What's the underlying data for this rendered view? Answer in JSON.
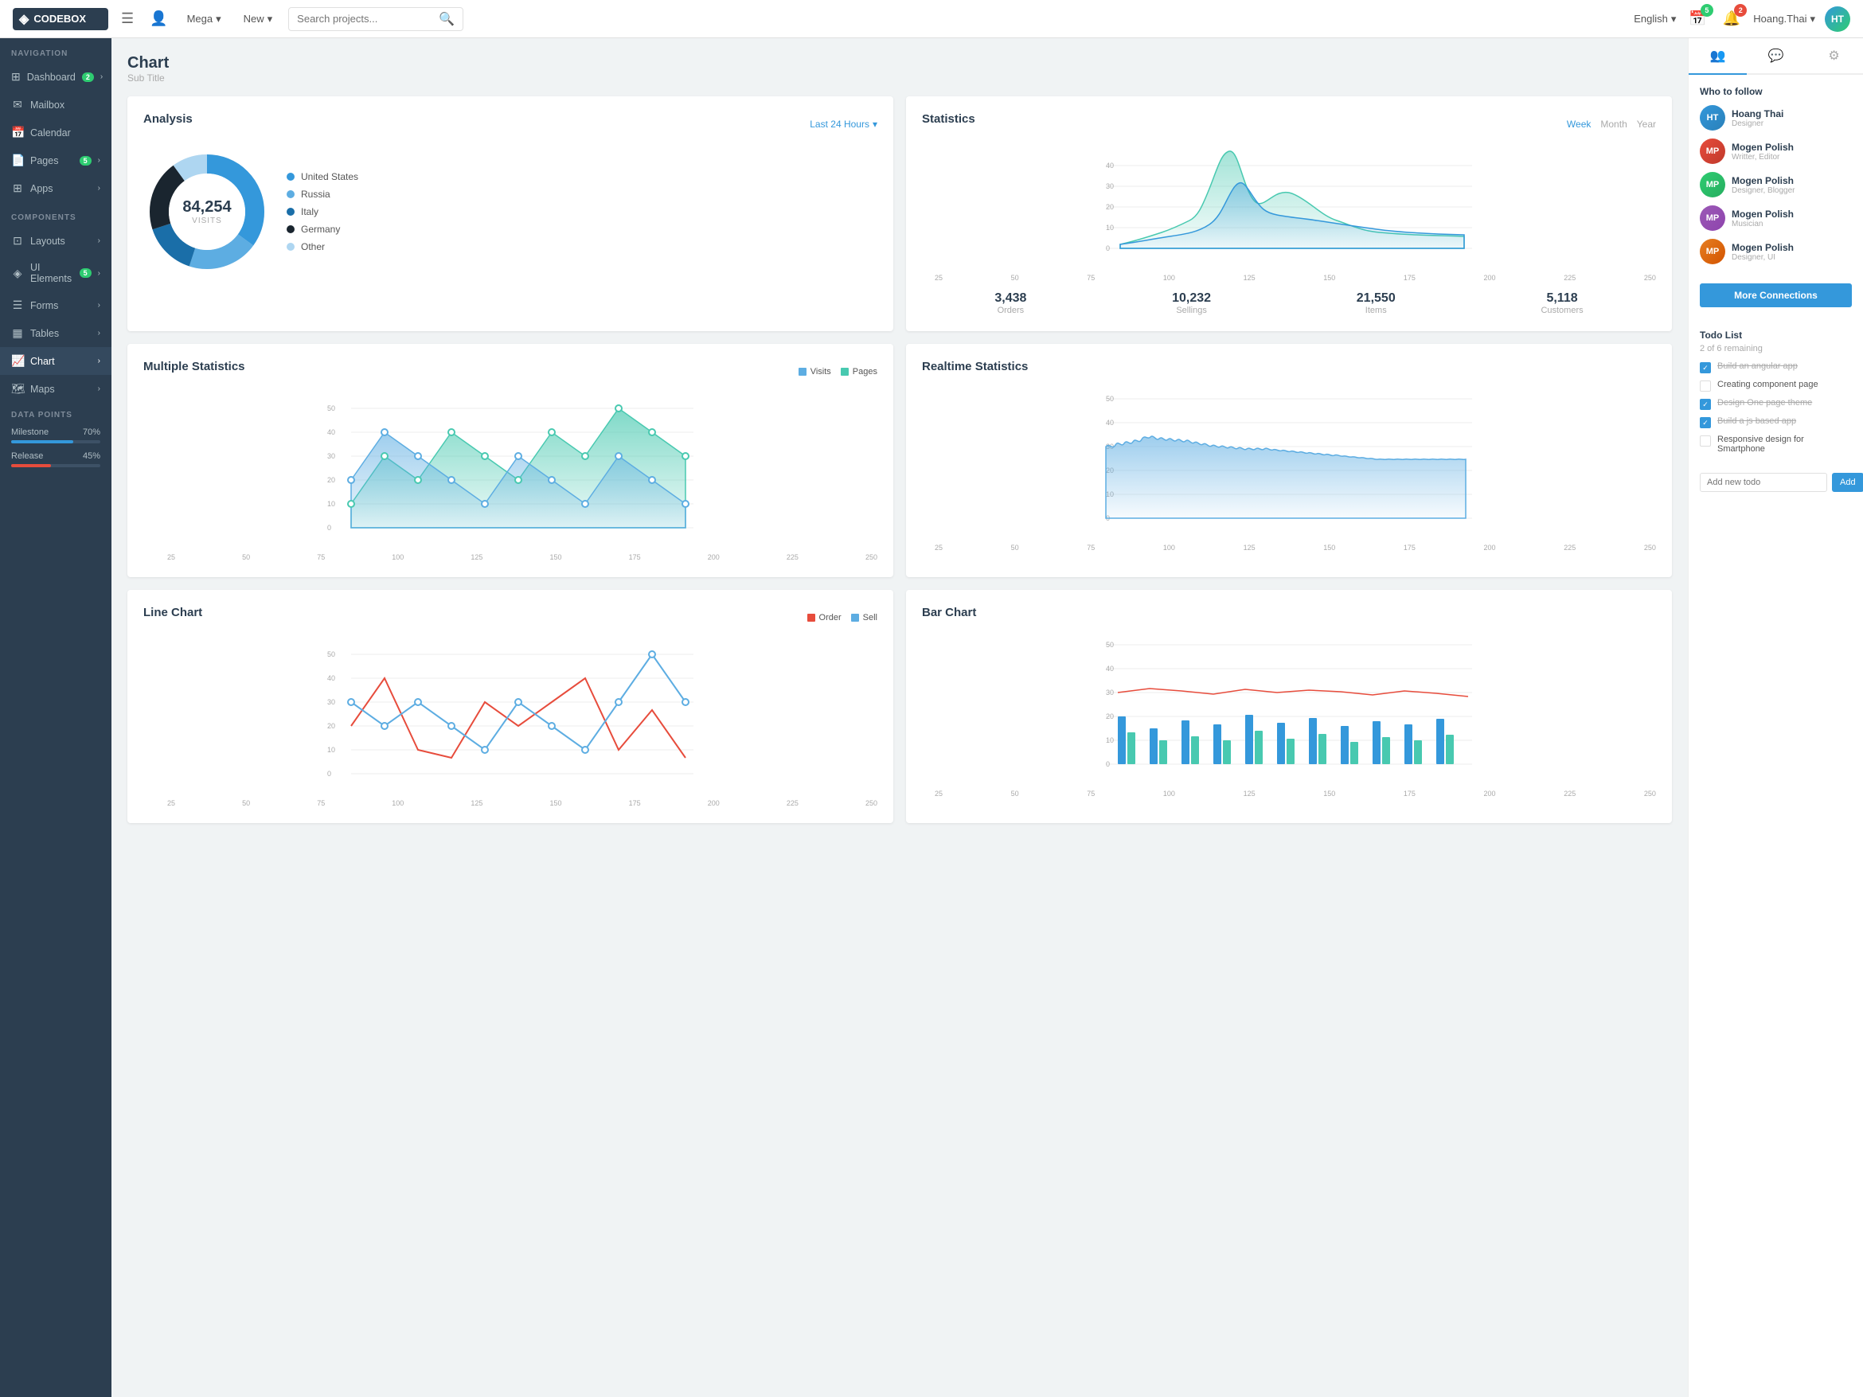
{
  "topnav": {
    "logo_text": "CODEBOX",
    "menu_btn": "☰",
    "user_icon": "👤",
    "mega_label": "Mega",
    "new_label": "New",
    "search_placeholder": "Search projects...",
    "lang_label": "English",
    "calendar_badge": "5",
    "bell_badge": "2",
    "username": "Hoang.Thai"
  },
  "sidebar": {
    "nav_label": "Navigation",
    "items": [
      {
        "label": "Dashboard",
        "icon": "⊞",
        "badge": "2",
        "arrow": "›"
      },
      {
        "label": "Mailbox",
        "icon": "✉"
      },
      {
        "label": "Calendar",
        "icon": "📅"
      },
      {
        "label": "Pages",
        "icon": "📄",
        "badge": "5",
        "arrow": "›"
      },
      {
        "label": "Apps",
        "icon": "⊞",
        "arrow": "›"
      }
    ],
    "components_label": "Components",
    "components": [
      {
        "label": "Layouts",
        "icon": "⊡",
        "arrow": "›"
      },
      {
        "label": "UI Elements",
        "icon": "◈",
        "badge": "5",
        "arrow": "›"
      },
      {
        "label": "Forms",
        "icon": "☰",
        "arrow": "›"
      },
      {
        "label": "Tables",
        "icon": "▦",
        "arrow": "›"
      },
      {
        "label": "Chart",
        "icon": "📈",
        "arrow": "›"
      },
      {
        "label": "Maps",
        "icon": "🗺",
        "arrow": "›"
      }
    ],
    "data_points_label": "Data Points",
    "milestone_label": "Milestone",
    "milestone_pct": "70%",
    "milestone_val": 70,
    "release_label": "Release",
    "release_pct": "45%",
    "release_val": 45
  },
  "page": {
    "title": "Chart",
    "subtitle": "Sub Title"
  },
  "analysis": {
    "title": "Analysis",
    "time_selector": "Last 24 Hours",
    "donut_value": "84,254",
    "donut_label": "VISITS",
    "legend": [
      {
        "label": "United States",
        "color": "#3498db"
      },
      {
        "label": "Russia",
        "color": "#5dade2"
      },
      {
        "label": "Italy",
        "color": "#2c3e50"
      },
      {
        "label": "Germany",
        "color": "#1a252f"
      },
      {
        "label": "Other",
        "color": "#aed6f1"
      }
    ]
  },
  "statistics": {
    "title": "Statistics",
    "tabs": [
      "Week",
      "Month",
      "Year"
    ],
    "active_tab": "Week",
    "stats": [
      {
        "value": "3,438",
        "label": "Orders"
      },
      {
        "value": "10,232",
        "label": "Sellings"
      },
      {
        "value": "21,550",
        "label": "Items"
      },
      {
        "value": "5,118",
        "label": "Customers"
      }
    ]
  },
  "multiple_stats": {
    "title": "Multiple Statistics",
    "legend": [
      {
        "label": "Visits",
        "color": "#5dade2"
      },
      {
        "label": "Pages",
        "color": "#48c9b0"
      }
    ]
  },
  "realtime": {
    "title": "Realtime Statistics"
  },
  "line_chart": {
    "title": "Line Chart",
    "legend": [
      {
        "label": "Order",
        "color": "#e74c3c"
      },
      {
        "label": "Sell",
        "color": "#5dade2"
      }
    ]
  },
  "bar_chart": {
    "title": "Bar Chart"
  },
  "right_panel": {
    "tabs": [
      "👥",
      "💬",
      "⚙"
    ],
    "who_to_follow": "Who to follow",
    "followers": [
      {
        "name": "Hoang Thai",
        "role": "Designer",
        "color": "#3498db"
      },
      {
        "name": "Mogen Polish",
        "role": "Writter, Editor",
        "color": "#e74c3c"
      },
      {
        "name": "Mogen Polish",
        "role": "Designer, Blogger",
        "color": "#2ecc71"
      },
      {
        "name": "Mogen Polish",
        "role": "Musician",
        "color": "#9b59b6"
      },
      {
        "name": "Mogen Polish",
        "role": "Designer, UI",
        "color": "#e67e22"
      }
    ],
    "more_connections_label": "More Connections",
    "todo_title": "Todo List",
    "todo_sub": "2 of 6 remaining",
    "todos": [
      {
        "text": "Build an angular app",
        "checked": true
      },
      {
        "text": "Creating component page",
        "checked": false
      },
      {
        "text": "Design One page theme",
        "checked": true
      },
      {
        "text": "Build a js based app",
        "checked": true
      },
      {
        "text": "Responsive design for Smartphone",
        "checked": false
      }
    ],
    "todo_placeholder": "Add new todo",
    "add_label": "Add"
  },
  "x_labels": [
    "25",
    "50",
    "75",
    "100",
    "125",
    "150",
    "175",
    "200",
    "225",
    "250"
  ]
}
